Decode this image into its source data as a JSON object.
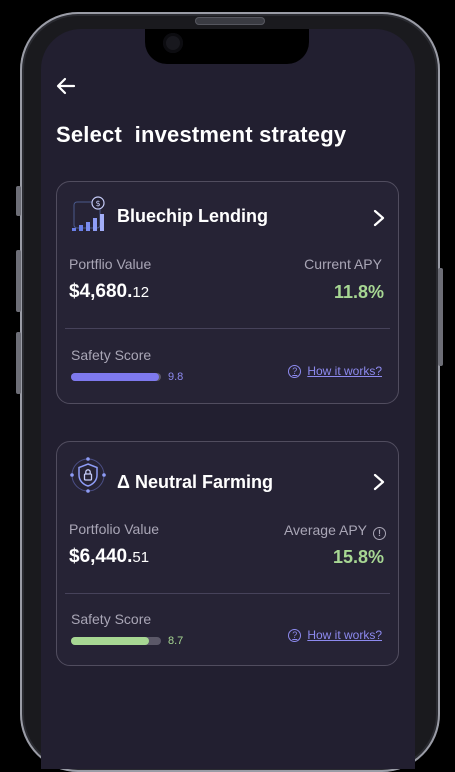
{
  "header": {
    "back_icon": "arrow-left-icon",
    "title": "Select  investment strategy"
  },
  "strategies": [
    {
      "name": "Bluechip Lending",
      "icon": "bar-chart-coin-icon",
      "portfolio_label": "Portflio Value",
      "portfolio_main": "$4,680.",
      "portfolio_cents": "12",
      "apy_label": "Current APY",
      "apy_value": "11.8%",
      "safety_label": "Safety Score",
      "safety_score": "9.8",
      "safety_fraction": 0.98,
      "safety_color": "#7e79ee",
      "how_label": "How it works?"
    },
    {
      "name": "Δ Neutral Farming",
      "icon": "shield-lock-icon",
      "portfolio_label": "Portfolio Value",
      "portfolio_main": "$6,440.",
      "portfolio_cents": "51",
      "apy_label": "Average APY",
      "apy_value": "15.8%",
      "safety_label": "Safety Score",
      "safety_score": "8.7",
      "safety_fraction": 0.87,
      "safety_color": "#a7d793",
      "how_label": "How it works?"
    }
  ],
  "colors": {
    "background": "#221f30",
    "card": "#262335",
    "accent_purple": "#8d8aef",
    "apy_green": "#a7d793"
  }
}
